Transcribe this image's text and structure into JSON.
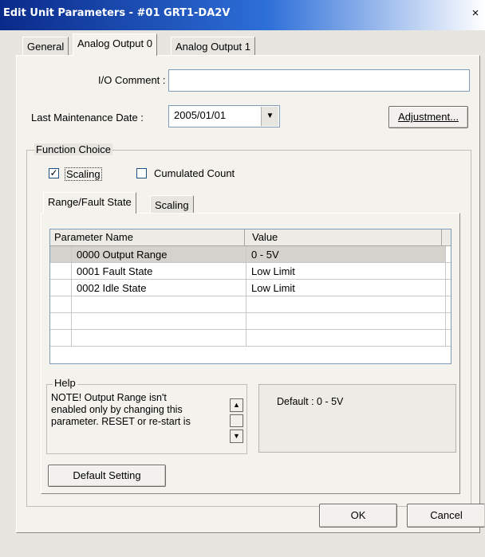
{
  "window": {
    "title": "Edit Unit Parameters - #01 GRT1-DA2V",
    "close_glyph": "×"
  },
  "tabs": [
    {
      "label": "General"
    },
    {
      "label": "Analog Output 0"
    },
    {
      "label": "Analog Output 1"
    }
  ],
  "fields": {
    "io_comment_label": "I/O Comment :",
    "io_comment_value": "",
    "maintenance_label": "Last Maintenance Date :",
    "maintenance_value": "2005/01/01",
    "adjustment_button": "Adjustment..."
  },
  "function_choice": {
    "label": "Function Choice",
    "scaling_label": "Scaling",
    "scaling_checked": true,
    "cumulated_label": "Cumulated Count",
    "cumulated_checked": false
  },
  "inner_tabs": [
    {
      "label": "Range/Fault State"
    },
    {
      "label": "Scaling"
    }
  ],
  "table": {
    "headers": [
      "Parameter Name",
      "Value"
    ],
    "rows": [
      {
        "name": "0000 Output Range",
        "value": "0 - 5V"
      },
      {
        "name": "0001 Fault State",
        "value": "Low Limit"
      },
      {
        "name": "0002 Idle State",
        "value": "Low Limit"
      }
    ]
  },
  "help": {
    "label": "Help",
    "text_line1": "NOTE! Output Range isn't",
    "text_line2": "enabled only by changing this",
    "text_line3": "parameter. RESET or re-start is",
    "default_text": "Default : 0 - 5V"
  },
  "default_setting_button": "Default Setting",
  "footer": {
    "ok": "OK",
    "cancel": "Cancel"
  },
  "colors": {
    "title_bar_start": "#0a2a8a",
    "title_bar_end": "#2d6fd8",
    "dialog_bg": "#e6e5df",
    "selected_row": "#d4d2cc"
  }
}
